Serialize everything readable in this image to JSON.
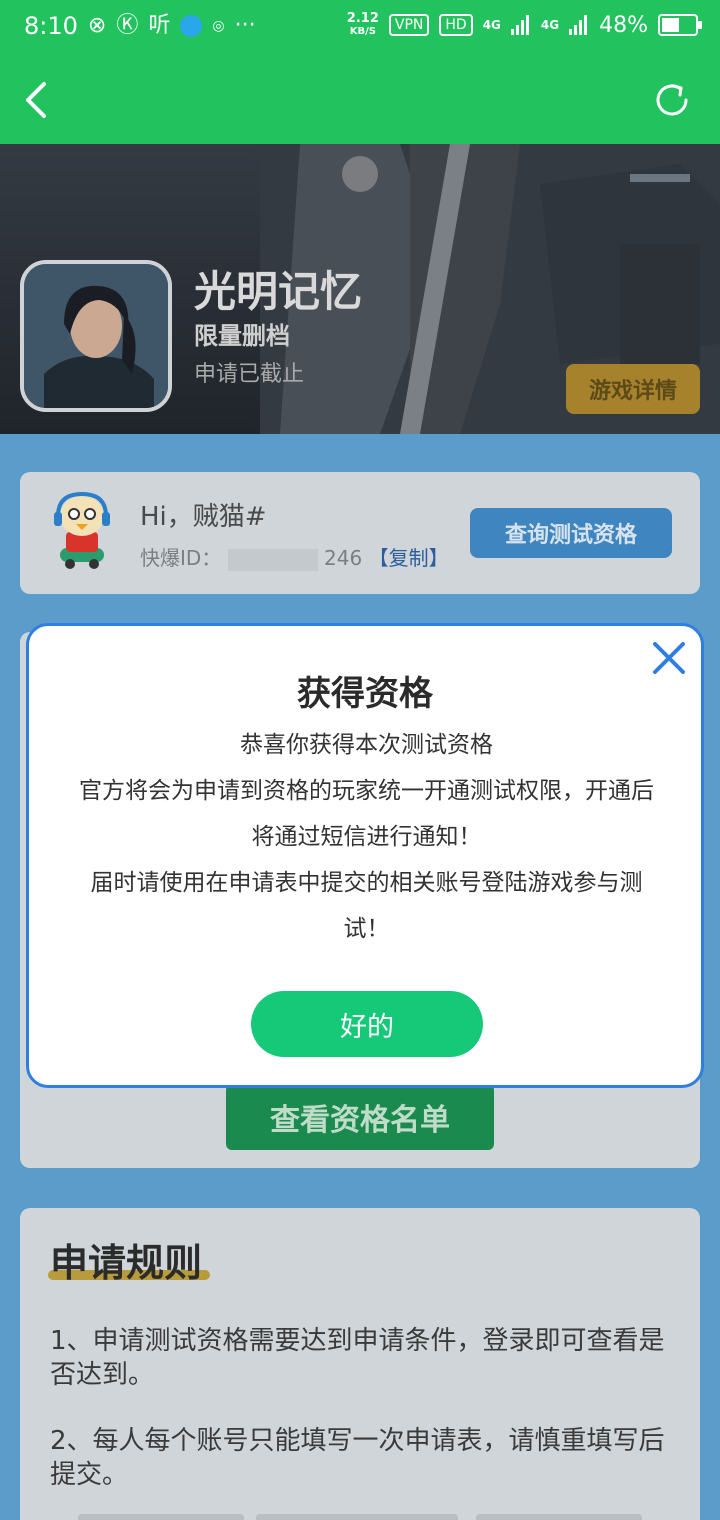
{
  "status_bar": {
    "time": "8:10",
    "left_glyphs": [
      "⊗",
      "Ⓚ",
      "听"
    ],
    "more": "···",
    "speed_value": "2.12",
    "speed_unit": "KB/S",
    "vpn": "VPN",
    "hd": "HD",
    "net1": "4G",
    "net2": "4G",
    "battery": "48%"
  },
  "nav": {
    "back_icon": "chevron-left-icon",
    "refresh_icon": "refresh-icon",
    "bar_color": "#22c35e"
  },
  "game": {
    "title": "光明记忆",
    "subtitle": "限量删档",
    "status": "申请已截止",
    "detail_button": "游戏详情"
  },
  "user": {
    "greeting": "Hi，贼猫#",
    "id_label": "快爆ID：",
    "id_suffix": "246",
    "copy_label": "【复制】",
    "query_button": "查询测试资格"
  },
  "middle": {
    "list_button": "查看资格名单"
  },
  "rules": {
    "title": "申请规则",
    "items": [
      "1、申请测试资格需要达到申请条件，登录即可查看是否达到。",
      "2、每人每个账号只能填写一次申请表，请慎重填写后提交。"
    ]
  },
  "modal": {
    "title": "获得资格",
    "line1": "恭喜你获得本次测试资格",
    "line2": "官方将会为申请到资格的玩家统一开通测试权限，开通后将通过短信进行通知！",
    "line3": "届时请使用在申请表中提交的相关账号登陆游戏参与测试！",
    "ok_button": "好的",
    "close_icon": "close-icon",
    "accent_color": "#2f7fe0",
    "button_color": "#16c978"
  }
}
